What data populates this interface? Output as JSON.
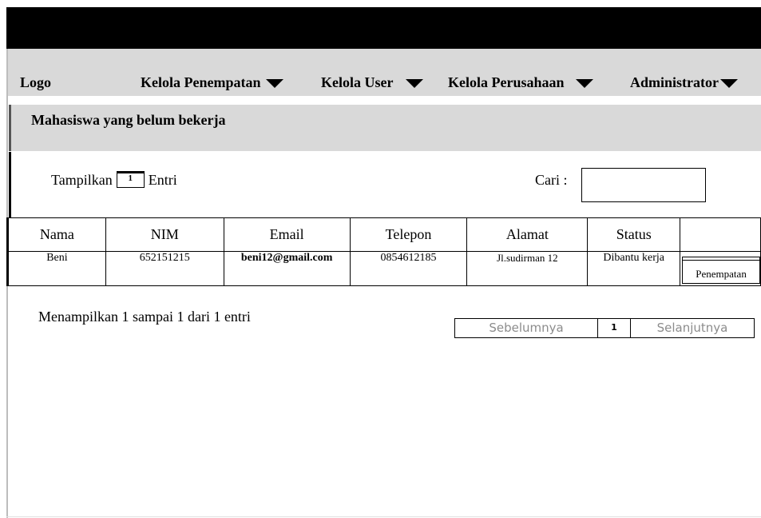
{
  "nav": {
    "logo": "Logo",
    "items": [
      {
        "label": "Kelola Penempatan"
      },
      {
        "label": "Kelola User"
      },
      {
        "label": "Kelola Perusahaan"
      },
      {
        "label": "Administrator"
      }
    ]
  },
  "panel": {
    "title": "Mahasiswa yang belum bekerja"
  },
  "controls": {
    "show_prefix": "Tampilkan",
    "show_value": "1",
    "show_suffix": "Entri",
    "search_label": "Cari :",
    "search_value": ""
  },
  "table": {
    "headers": [
      "Nama",
      "NIM",
      "Email",
      "Telepon",
      "Alamat",
      "Status",
      ""
    ],
    "rows": [
      {
        "nama": "Beni",
        "nim": "652151215",
        "email": "beni12@gmail.com",
        "telepon": "0854612185",
        "alamat": "Jl.sudirman 12",
        "status": "Dibantu kerja",
        "action": "Penempatan"
      }
    ]
  },
  "footer": {
    "info": "Menampilkan 1 sampai 1 dari 1 entri",
    "prev": "Sebelumnya",
    "page": "1",
    "next": "Selanjutnya"
  },
  "colors": {
    "header_bg": "#000000",
    "nav_bg": "#d9d9d9",
    "pager_text": "#8c8c8c"
  }
}
